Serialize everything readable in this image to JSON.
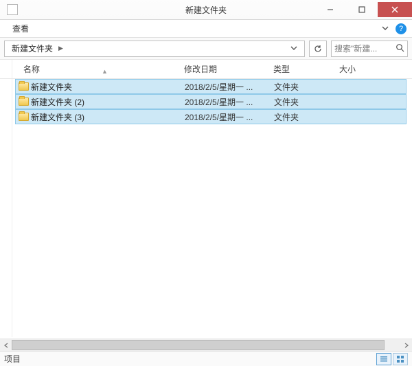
{
  "window": {
    "title": "新建文件夹"
  },
  "menu": {
    "view": "查看"
  },
  "address": {
    "crumb": "新建文件夹"
  },
  "search": {
    "placeholder": "搜索\"新建..."
  },
  "columns": {
    "name": "名称",
    "date": "修改日期",
    "type": "类型",
    "size": "大小"
  },
  "rows": [
    {
      "name": "新建文件夹",
      "date": "2018/2/5/星期一 ...",
      "type": "文件夹"
    },
    {
      "name": "新建文件夹 (2)",
      "date": "2018/2/5/星期一 ...",
      "type": "文件夹"
    },
    {
      "name": "新建文件夹 (3)",
      "date": "2018/2/5/星期一 ...",
      "type": "文件夹"
    }
  ],
  "status": {
    "text": "项目"
  }
}
